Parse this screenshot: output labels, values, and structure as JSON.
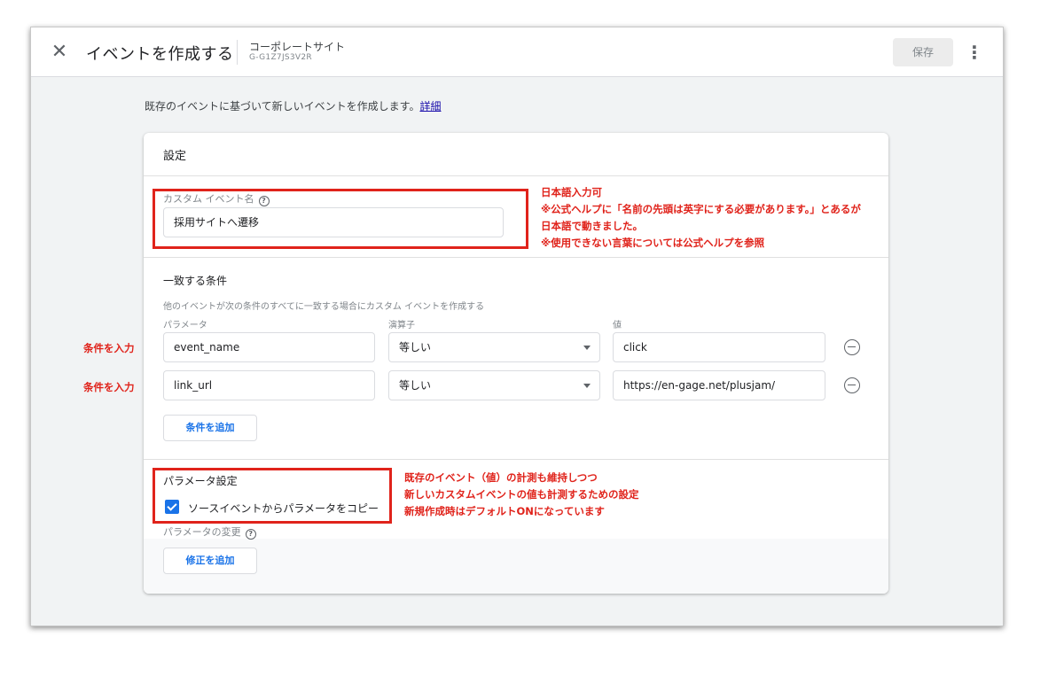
{
  "header": {
    "close_icon": "close-icon",
    "title": "イベントを作成する",
    "property_name": "コーポレートサイト",
    "property_id": "G-G1Z7JS3V2R",
    "save_label": "保存",
    "more_icon": "more-vert-icon"
  },
  "intro": {
    "text": "既存のイベントに基づいて新しいイベントを作成します。",
    "link": "詳細"
  },
  "settings": {
    "title": "設定",
    "custom_event_label": "カスタム イベント名",
    "custom_event_value": "採用サイトへ遷移"
  },
  "conditions": {
    "title": "一致する条件",
    "description": "他のイベントが次の条件のすべてに一致する場合にカスタム イベントを作成する",
    "col_parameter": "パラメータ",
    "col_operator": "演算子",
    "col_value": "値",
    "rows": [
      {
        "parameter": "event_name",
        "operator": "等しい",
        "value": "click"
      },
      {
        "parameter": "link_url",
        "operator": "等しい",
        "value": "https://en-gage.net/plusjam/"
      }
    ],
    "add_label": "条件を追加"
  },
  "params": {
    "title": "パラメータ設定",
    "copy_label": "ソースイベントからパラメータをコピー",
    "copy_checked": true,
    "modify_label": "パラメータの変更",
    "add_modify_label": "修正を追加"
  },
  "annotations": {
    "event_name_note": [
      "日本語入力可",
      "※公式ヘルプに「名前の先頭は英字にする必要があります。」とあるが",
      "日本語で動きました。",
      "※使用できない言葉については公式ヘルプを参照"
    ],
    "row1_note": "条件を入力",
    "row2_note": "条件を入力",
    "params_note": [
      "既存のイベント（値）の計測も維持しつつ",
      "新しいカスタムイベントの値も計測するための設定",
      "新規作成時はデフォルトONになっています"
    ]
  },
  "colors": {
    "accent": "#1a73e8",
    "annotation": "#e0231b"
  }
}
